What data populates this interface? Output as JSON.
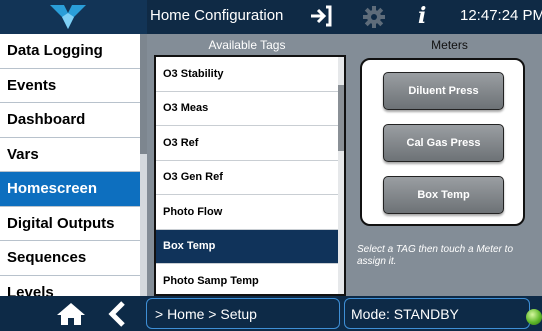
{
  "header": {
    "logo_icon": "teledyne-logo",
    "title": "Home Configuration",
    "exit_icon": "exit-icon",
    "settings_icon": "gear-icon",
    "info_icon": "info-icon",
    "info_glyph": "i",
    "clock": "12:47:24 PM"
  },
  "sidebar": {
    "items": [
      {
        "label": "Data Logging",
        "active": false
      },
      {
        "label": "Events",
        "active": false
      },
      {
        "label": "Dashboard",
        "active": false
      },
      {
        "label": "Vars",
        "active": false
      },
      {
        "label": "Homescreen",
        "active": true
      },
      {
        "label": "Digital Outputs",
        "active": false
      },
      {
        "label": "Sequences",
        "active": false
      },
      {
        "label": "Levels",
        "active": false
      }
    ]
  },
  "main": {
    "tags_header": "Available Tags",
    "meters_header": "Meters",
    "tags": [
      {
        "label": "O3 Stability",
        "selected": false
      },
      {
        "label": "O3 Meas",
        "selected": false
      },
      {
        "label": "O3 Ref",
        "selected": false
      },
      {
        "label": "O3 Gen Ref",
        "selected": false
      },
      {
        "label": "Photo Flow",
        "selected": false
      },
      {
        "label": "Box Temp",
        "selected": true
      },
      {
        "label": "Photo Samp Temp",
        "selected": false
      }
    ],
    "meters": [
      "Diluent Press",
      "Cal Gas Press",
      "Box Temp"
    ],
    "hint": "Select a TAG then touch a Meter to assign it."
  },
  "footer": {
    "home_icon": "home-icon",
    "back_icon": "chevron-left-icon",
    "breadcrumb": "> Home > Setup",
    "mode": "Mode: STANDBY",
    "status_led_color": "#5fb82a"
  },
  "colors": {
    "accent": "#0d6fbf",
    "selected_tag": "#10335a",
    "panel": "#838d97"
  }
}
